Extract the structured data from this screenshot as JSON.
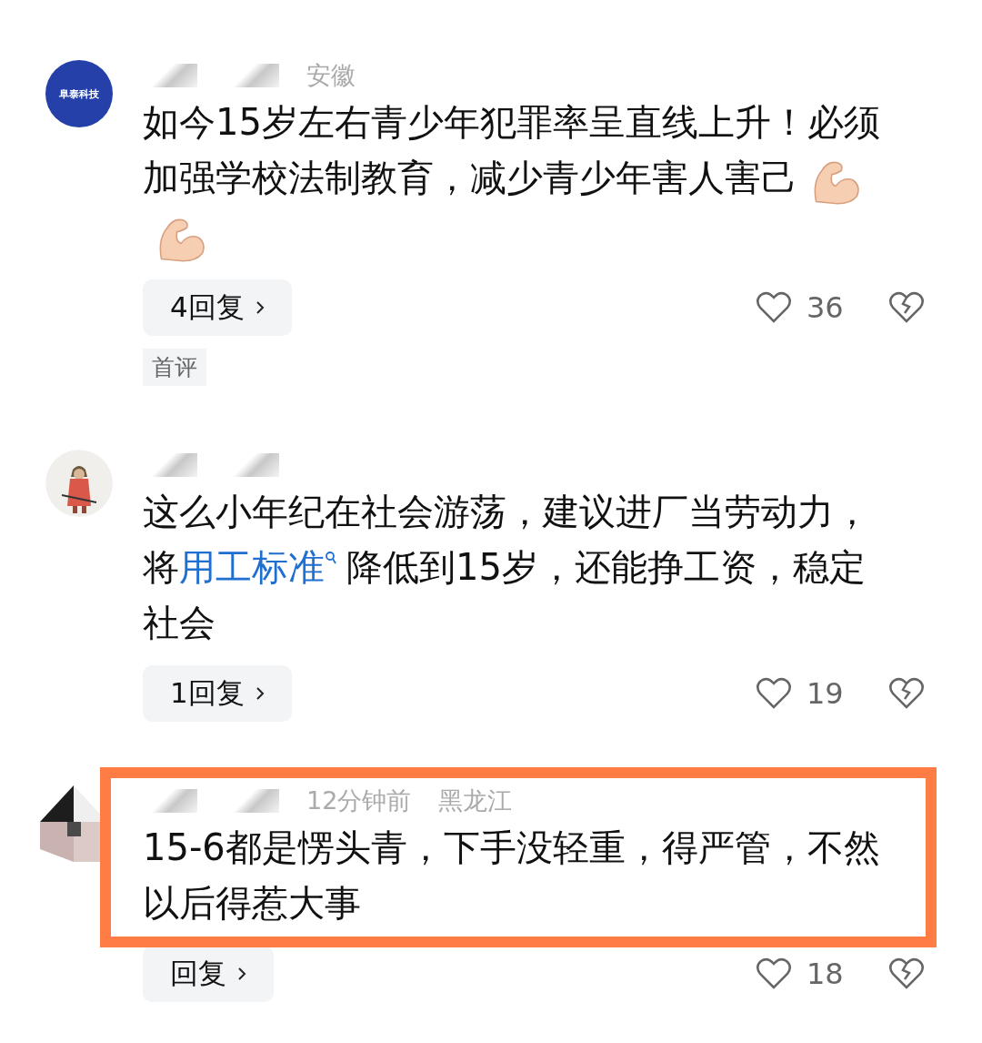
{
  "comments": [
    {
      "avatar": {
        "kind": "logo",
        "text": "阜泰科技"
      },
      "meta": [
        "安徽"
      ],
      "body": [
        {
          "kind": "text",
          "text": "如今15岁左右青少年犯罪率呈直线上升！必须加强学校法制教育，减少青少年害人害己"
        },
        {
          "kind": "emoji"
        },
        {
          "kind": "emoji"
        }
      ],
      "replies": "4回复",
      "likes": "36",
      "tag": "首评",
      "highlighted": false
    },
    {
      "avatar": {
        "kind": "figure"
      },
      "body": [
        {
          "kind": "text",
          "text": "这么小年纪在社会游荡，建议进厂当劳动力，将"
        },
        {
          "kind": "link",
          "text": "用工标准"
        },
        {
          "kind": "text",
          "text": "降低到15岁，还能挣工资，稳定社会"
        }
      ],
      "replies": "1回复",
      "likes": "19",
      "highlighted": false
    },
    {
      "avatar": {
        "kind": "pattern"
      },
      "meta": [
        "12分钟前",
        "黑龙江"
      ],
      "body": [
        {
          "kind": "text",
          "text": "15-6都是愣头青，下手没轻重，得严管，不然以后得惹大事"
        }
      ],
      "replies": "回复",
      "likes": "18",
      "highlighted": true
    }
  ]
}
